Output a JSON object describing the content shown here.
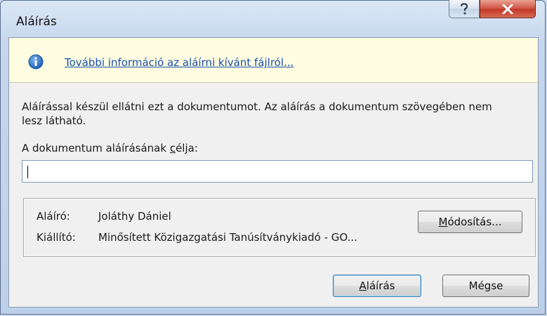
{
  "window": {
    "title": "Aláírás"
  },
  "info_bar": {
    "link_text": "További információ az aláírni kívánt fájlról..."
  },
  "description": "Aláírással készül ellátni ezt a dokumentumot. Az aláírás a dokumentum szövegében nem lesz látható.",
  "purpose": {
    "label_before": "A dokumentum aláírásának ",
    "label_access": "c",
    "label_after": "élja:",
    "value": ""
  },
  "signer": {
    "signer_label": "Aláíró:",
    "signer_value": "Joláthy Dániel",
    "issuer_label": "Kiállító:",
    "issuer_value": "Minősített Közigazgatási Tanúsítványkiadó - GO...",
    "change_button": {
      "access": "M",
      "rest": "ódosítás..."
    }
  },
  "buttons": {
    "sign": {
      "access": "A",
      "rest": "láírás"
    },
    "cancel": "Mégse"
  },
  "colors": {
    "info_bar_bg": "#fffde1",
    "link": "#1a4fb0",
    "close_button": "#c43a29",
    "default_button_border": "#3c7fb1"
  }
}
